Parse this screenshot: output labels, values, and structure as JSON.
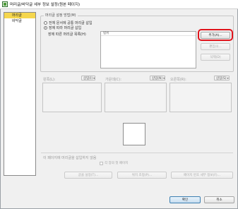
{
  "window": {
    "title": "머리글/바닥글 세부 정보 설정(원본 페이지)"
  },
  "sidebar": {
    "items": [
      {
        "label": "머리글",
        "selected": true
      },
      {
        "label": "바닥글",
        "selected": false
      }
    ]
  },
  "method_group": {
    "title": "머리글 설정 방법(M)",
    "options": [
      {
        "label": "전체 문서에 공통 머리글 삽입",
        "checked": false
      },
      {
        "label": "장에 따라 머리글 삽입",
        "checked": true
      }
    ],
    "list_label": "장에 따른 머리글 목록(H)",
    "list_header": "범위",
    "buttons": {
      "add": "추가(A)...",
      "edit": "편집(I)...",
      "delete": "삭제(D)"
    }
  },
  "position_lists": {
    "left": {
      "label": "왼쪽(L):",
      "insert": "삽입(I)"
    },
    "center": {
      "label": "가운데(C):",
      "insert": "삽입(N)"
    },
    "right": {
      "label": "오른쪽(R):",
      "insert": "삽입(S)"
    }
  },
  "options": {
    "no_first_page_label": "이 페이지에 머리글을 삽입하지 않음",
    "chapter_checkbox": "각 장의 첫 페이지"
  },
  "bottom_buttons": {
    "font": "글꼴 설정(T)...",
    "position": "위치 조정(P)...",
    "page_number": "페이지 번호 세부 정보(F)..."
  },
  "dialog_buttons": {
    "ok": "확인",
    "cancel": "취소"
  },
  "colors": {
    "selection": "#f5d64d",
    "highlight_ring": "#e0141c"
  }
}
